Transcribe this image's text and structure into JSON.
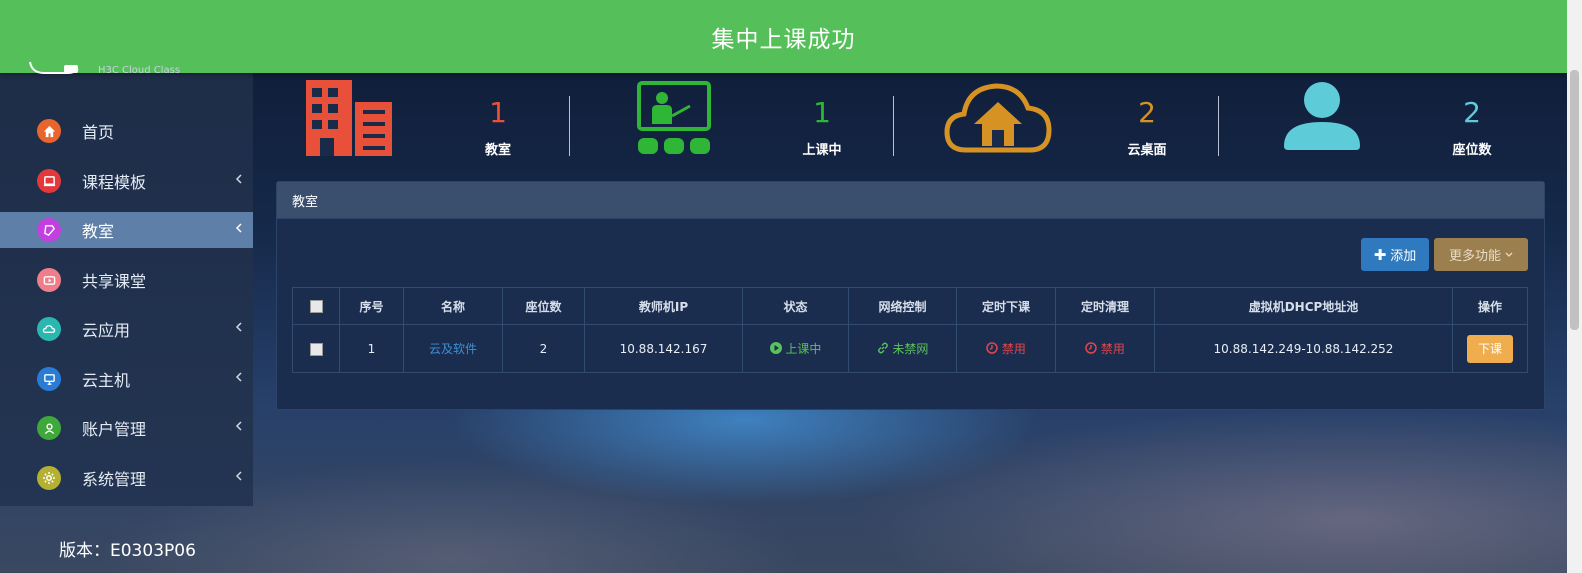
{
  "toast": {
    "message": "集中上课成功"
  },
  "brand": {
    "subtitle": "H3C Cloud Class"
  },
  "sidebar": {
    "items": [
      {
        "label": "首页",
        "icon": "home-icon",
        "color": "#e8662e",
        "has_caret": false,
        "active": false
      },
      {
        "label": "课程模板",
        "icon": "template-icon",
        "color": "#e4393c",
        "has_caret": true,
        "active": false
      },
      {
        "label": "教室",
        "icon": "classroom-icon",
        "color": "#c23fe0",
        "has_caret": true,
        "active": true
      },
      {
        "label": "共享课堂",
        "icon": "video-icon",
        "color": "#f07d8a",
        "has_caret": false,
        "active": false
      },
      {
        "label": "云应用",
        "icon": "cloud-app-icon",
        "color": "#2ab7b0",
        "has_caret": true,
        "active": false
      },
      {
        "label": "云主机",
        "icon": "monitor-icon",
        "color": "#2a7bd4",
        "has_caret": true,
        "active": false
      },
      {
        "label": "账户管理",
        "icon": "user-icon",
        "color": "#3fa83a",
        "has_caret": true,
        "active": false
      },
      {
        "label": "系统管理",
        "icon": "gear-icon",
        "color": "#b3b032",
        "has_caret": true,
        "active": false
      }
    ]
  },
  "version": {
    "text": "版本：E0303P06"
  },
  "stats": [
    {
      "value": "1",
      "label": "教室",
      "color": "#e8503a"
    },
    {
      "value": "1",
      "label": "上课中",
      "color": "#2fb636"
    },
    {
      "value": "2",
      "label": "云桌面",
      "color": "#d69324"
    },
    {
      "value": "2",
      "label": "座位数",
      "color": "#5ecbd8"
    }
  ],
  "panel": {
    "title": "教室",
    "add_label": "添加",
    "more_label": "更多功能",
    "columns": [
      "序号",
      "名称",
      "座位数",
      "教师机IP",
      "状态",
      "网络控制",
      "定时下课",
      "定时清理",
      "虚拟机DHCP地址池",
      "操作"
    ],
    "rows": [
      {
        "index": "1",
        "name": "云及软件",
        "seats": "2",
        "teacher_ip": "10.88.142.167",
        "status": "上课中",
        "network": "未禁网",
        "timed_end": "禁用",
        "timed_clean": "禁用",
        "dhcp_pool": "10.88.142.249-10.88.142.252",
        "action": "下课"
      }
    ]
  }
}
